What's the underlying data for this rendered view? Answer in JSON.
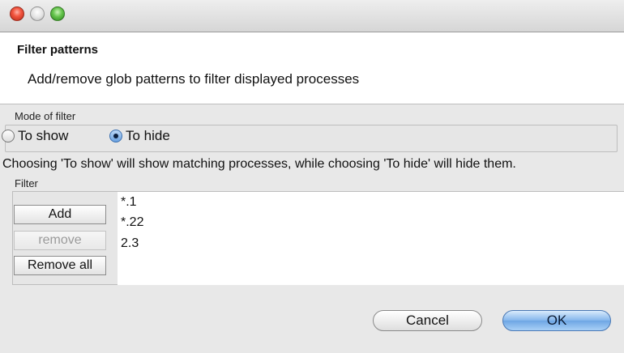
{
  "dialog": {
    "title": "Filter patterns",
    "description": "Add/remove glob patterns to filter displayed processes"
  },
  "mode": {
    "label": "Mode of filter",
    "options": [
      {
        "label": "To show",
        "selected": false
      },
      {
        "label": "To hide",
        "selected": true
      }
    ],
    "info": "Choosing 'To show' will show matching processes, while choosing 'To hide' will hide them."
  },
  "filter": {
    "label": "Filter",
    "patterns": [
      "*.1",
      "*.22",
      "2.3"
    ],
    "add_label": "Add",
    "remove_label": "remove",
    "remove_all_label": "Remove all"
  },
  "footer": {
    "cancel_label": "Cancel",
    "ok_label": "OK"
  },
  "colors": {
    "close": "#f2553f",
    "maximize": "#63c24a",
    "accent": "#6ea6e4"
  }
}
